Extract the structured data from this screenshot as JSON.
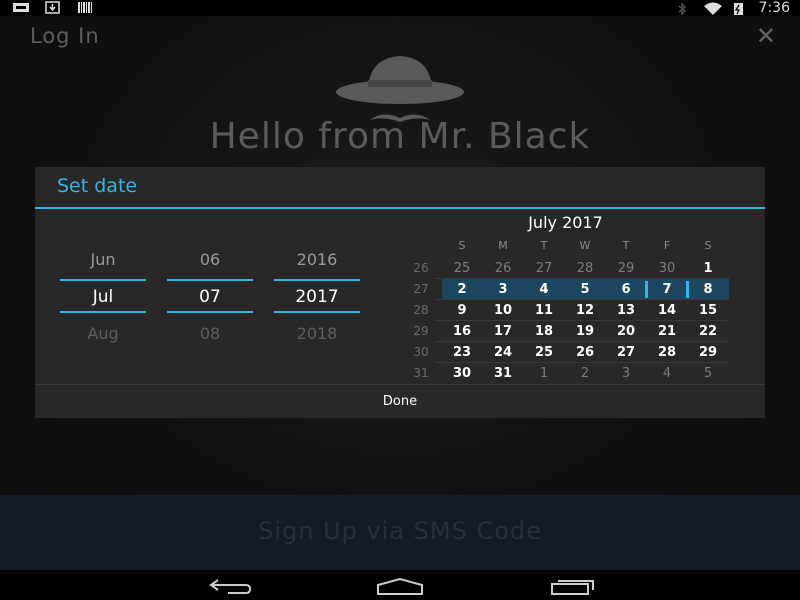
{
  "status_bar": {
    "left_icons": [
      "notification-card-icon",
      "download-icon",
      "barcode-icon"
    ],
    "right_icons": [
      "bluetooth-icon",
      "wifi-icon",
      "battery-charging-icon"
    ],
    "time": "7:36"
  },
  "app": {
    "title": "Log In",
    "close_glyph": "✕",
    "hello_text": "Hello from Mr. Black",
    "signup_label": "Sign Up via SMS Code"
  },
  "dialog": {
    "title": "Set date",
    "month_picker": {
      "prev": "Jun",
      "current": "Jul",
      "next": "Aug"
    },
    "day_picker": {
      "prev": "06",
      "current": "07",
      "next": "08"
    },
    "year_picker": {
      "prev": "2016",
      "current": "2017",
      "next": "2018"
    },
    "calendar": {
      "month_title": "July 2017",
      "weekdays": [
        "S",
        "M",
        "T",
        "W",
        "T",
        "F",
        "S"
      ],
      "weeks": [
        {
          "week": "26",
          "days": [
            "25",
            "26",
            "27",
            "28",
            "29",
            "30",
            "1"
          ]
        },
        {
          "week": "27",
          "days": [
            "2",
            "3",
            "4",
            "5",
            "6",
            "7",
            "8"
          ]
        },
        {
          "week": "28",
          "days": [
            "9",
            "10",
            "11",
            "12",
            "13",
            "14",
            "15"
          ]
        },
        {
          "week": "29",
          "days": [
            "16",
            "17",
            "18",
            "19",
            "20",
            "21",
            "22"
          ]
        },
        {
          "week": "30",
          "days": [
            "23",
            "24",
            "25",
            "26",
            "27",
            "28",
            "29"
          ]
        },
        {
          "week": "31",
          "days": [
            "30",
            "31",
            "1",
            "2",
            "3",
            "4",
            "5"
          ]
        }
      ],
      "selected_day": "7"
    },
    "done_label": "Done",
    "accent_color": "#33b5e5"
  },
  "navbar": {
    "buttons": [
      "back-icon",
      "home-icon",
      "recents-icon"
    ]
  }
}
